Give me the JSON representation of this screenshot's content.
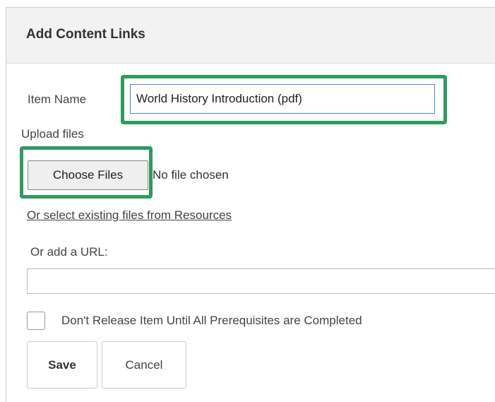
{
  "dialog": {
    "title": "Add Content Links"
  },
  "item_name": {
    "label": "Item Name",
    "value": "World History Introduction (pdf)"
  },
  "upload": {
    "label": "Upload files",
    "choose_button_label": "Choose Files",
    "status_text": "No file chosen",
    "resources_link": "Or select existing files from Resources"
  },
  "url": {
    "label": "Or add a URL:",
    "value": ""
  },
  "prerequisite": {
    "label": "Don't Release Item Until All Prerequisites are Completed",
    "checked": false
  },
  "actions": {
    "save_label": "Save",
    "cancel_label": "Cancel"
  },
  "colors": {
    "highlight": "#2e9b5f",
    "header_bg": "#f2f2f2",
    "input_focus_border": "#5b7fd6"
  }
}
